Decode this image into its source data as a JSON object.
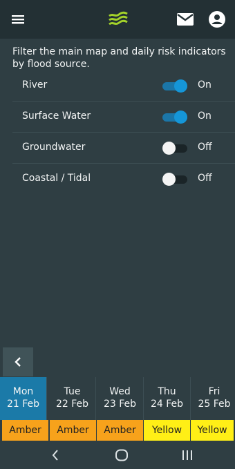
{
  "topbar": {
    "menu_icon": "hamburger-menu-icon",
    "logo_icon": "flood-waves-logo",
    "mail_icon": "mail-icon",
    "account_icon": "account-circle-icon",
    "logo_color": "#a3d22a"
  },
  "filter": {
    "intro": "Filter the main map and daily risk indicators by flood source.",
    "sources": [
      {
        "label": "River",
        "state": "On",
        "enabled": true
      },
      {
        "label": "Surface Water",
        "state": "On",
        "enabled": true
      },
      {
        "label": "Groundwater",
        "state": "Off",
        "enabled": false
      },
      {
        "label": "Coastal / Tidal",
        "state": "Off",
        "enabled": false
      }
    ]
  },
  "collapse_icon": "chevron-left-icon",
  "days": [
    {
      "day": "Mon",
      "date": "21 Feb",
      "selected": true
    },
    {
      "day": "Tue",
      "date": "22 Feb",
      "selected": false
    },
    {
      "day": "Wed",
      "date": "23 Feb",
      "selected": false
    },
    {
      "day": "Thu",
      "date": "24 Feb",
      "selected": false
    },
    {
      "day": "Fri",
      "date": "25 Feb",
      "selected": false
    }
  ],
  "risks": [
    {
      "label": "Amber",
      "color": "#f7a21b"
    },
    {
      "label": "Amber",
      "color": "#f7a21b"
    },
    {
      "label": "Amber",
      "color": "#f7a21b"
    },
    {
      "label": "Yellow",
      "color": "#ffef16"
    },
    {
      "label": "Yellow",
      "color": "#ffef16"
    }
  ],
  "navbar": {
    "back_icon": "back-icon",
    "home_icon": "home-icon",
    "recents_icon": "recents-icon"
  }
}
